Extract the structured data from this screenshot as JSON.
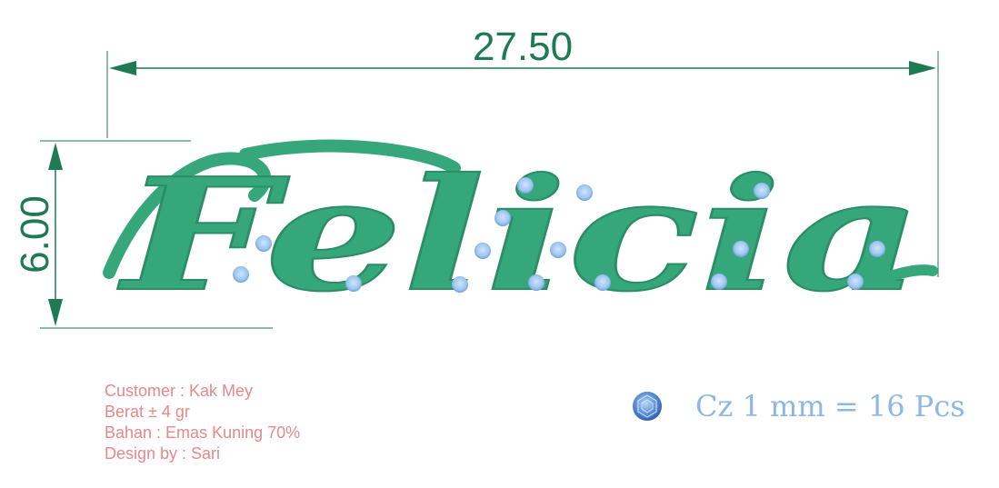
{
  "dimensions": {
    "width": "27.50",
    "height": "6.00"
  },
  "design": {
    "name": "Felicia",
    "body_color": "#35a77a",
    "dimension_color": "#1d7a52",
    "stone_color": "#8db7e8"
  },
  "info": {
    "customer": "Customer : Kak Mey",
    "weight": "Berat ± 4 gr",
    "material": "Bahan : Emas Kuning 70%",
    "designer": "Design by : Sari"
  },
  "legend": {
    "icon": "gem-icon",
    "text": "Cz 1 mm = 16 Pcs"
  }
}
